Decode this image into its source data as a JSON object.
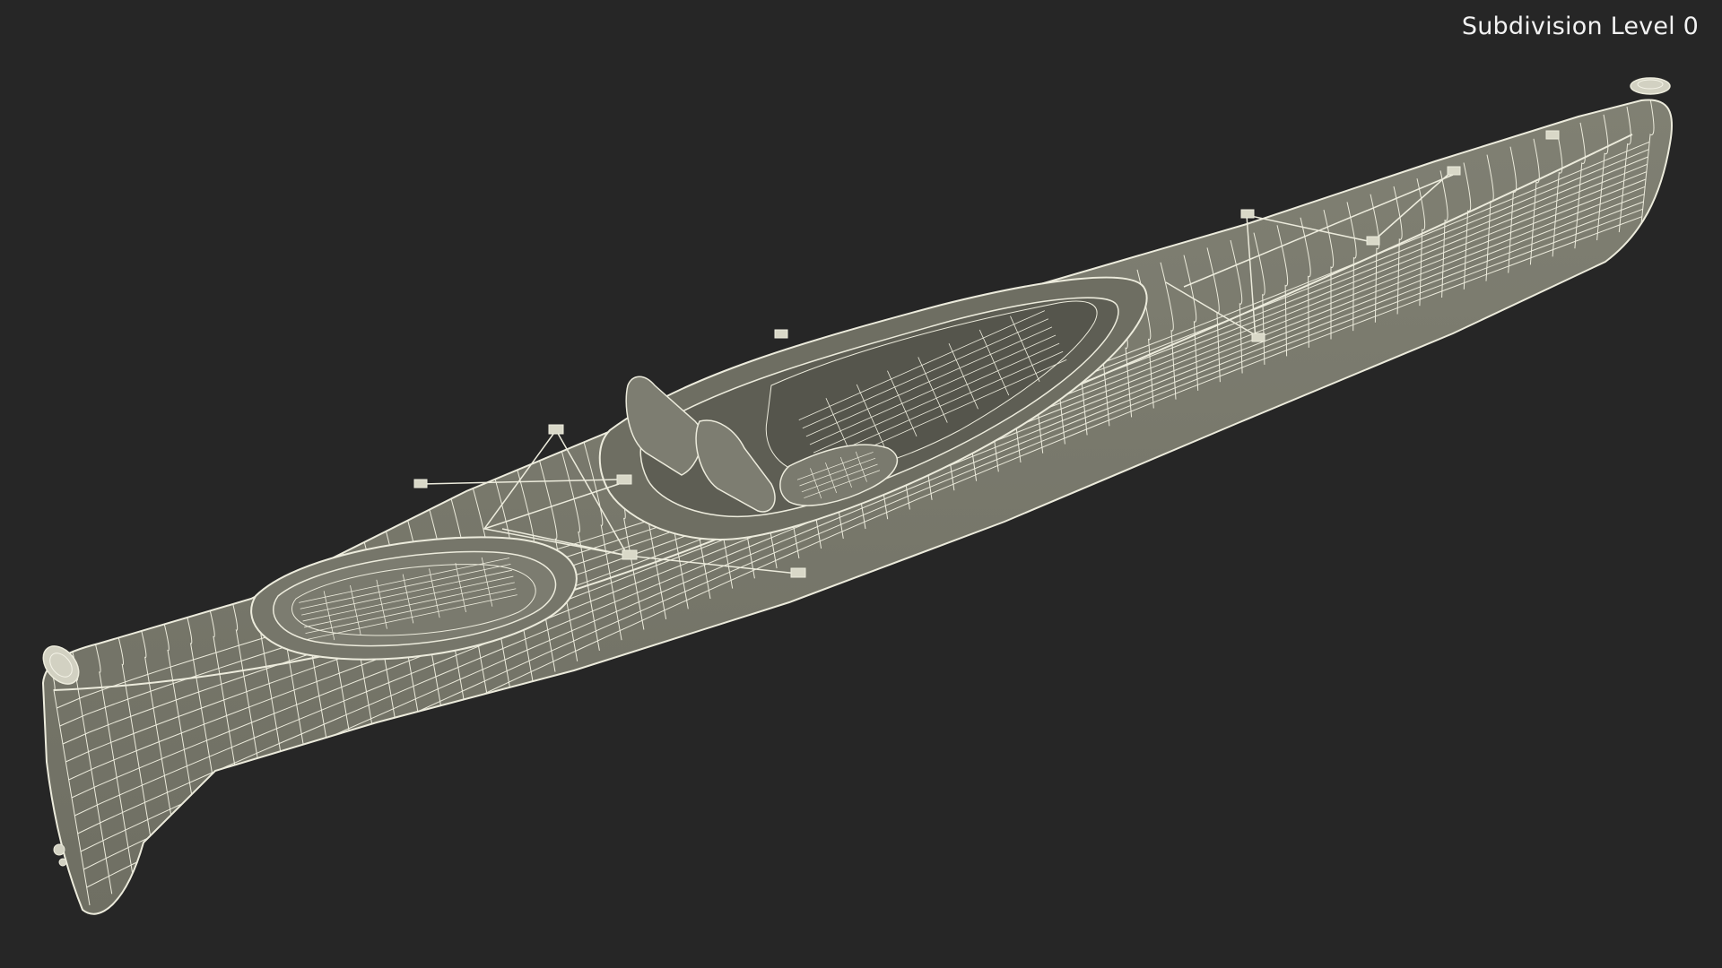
{
  "viewport": {
    "subdivision_label": "Subdivision Level 0",
    "background_color": "#262626",
    "model_fill_color": "#7a7a6c",
    "wire_color": "#ecebdc"
  }
}
